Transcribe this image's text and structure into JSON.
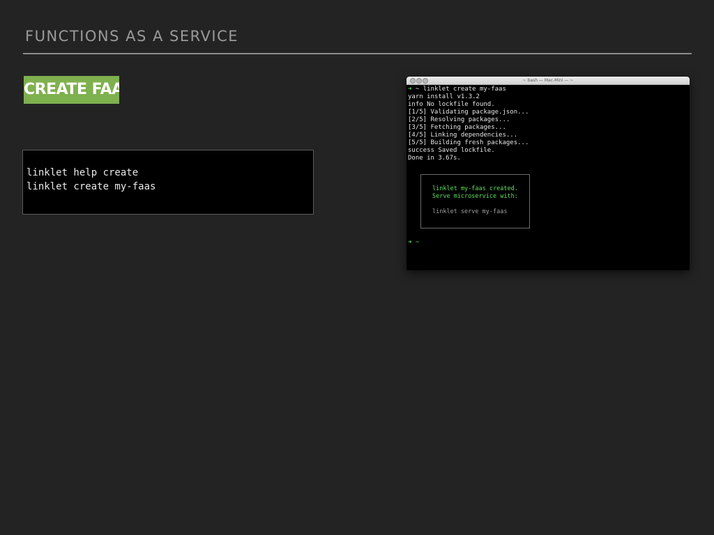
{
  "slide": {
    "heading": "FUNCTIONS AS A SERVICE",
    "tag": "CREATE FAAS"
  },
  "code_snippet": {
    "lines": [
      "linklet help create",
      "linklet create my-faas"
    ]
  },
  "terminal": {
    "title": "~ bash — Mac-Mini — ~",
    "prompt_arrow": "➜",
    "cwd": "~",
    "command": "linklet create my-faas",
    "output": [
      "yarn install v1.3.2",
      "info No lockfile found.",
      "[1/5] Validating package.json...",
      "[2/5] Resolving packages...",
      "[3/5] Fetching packages...",
      "[4/5] Linking dependencies...",
      "[5/5] Building fresh packages...",
      "success Saved lockfile.",
      "Done in 3.67s."
    ],
    "box": {
      "line1": "linklet my-faas created.",
      "line2": "Serve microservice with:",
      "line3": "linklet serve my-faas"
    },
    "final_prompt_arrow": "➜",
    "final_cwd": "~"
  },
  "colors": {
    "background": "#232323",
    "tag": "#7fb04e",
    "terminal_green": "#5fe05f"
  }
}
